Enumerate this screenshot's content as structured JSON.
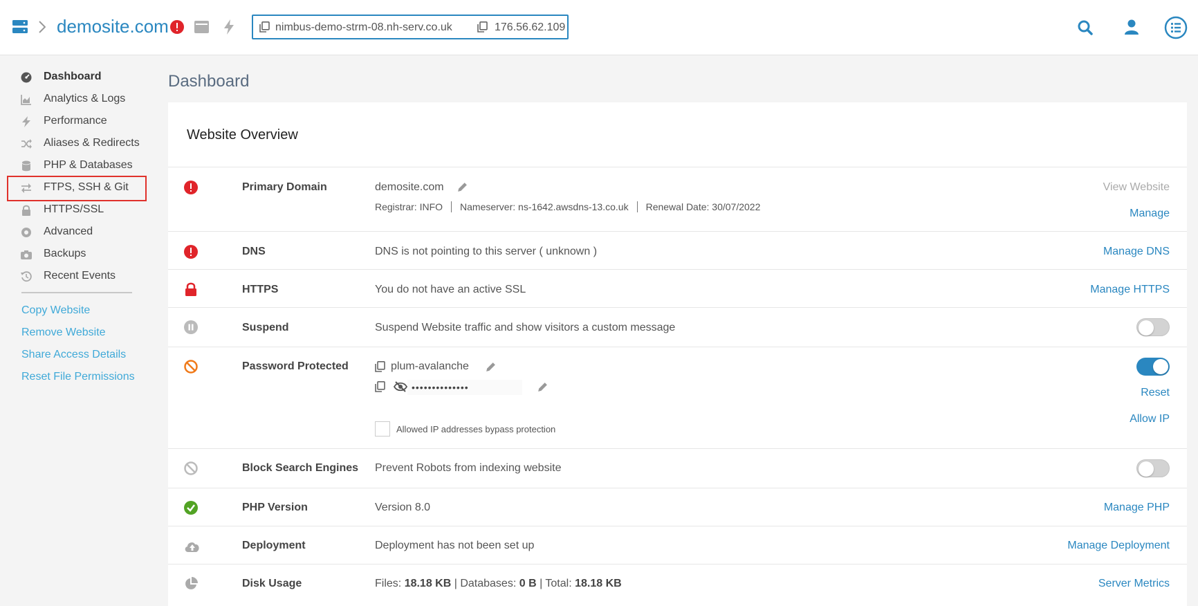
{
  "topbar": {
    "site_title": "demosite.com",
    "hostname": "nimbus-demo-strm-08.nh-serv.co.uk",
    "ip_address": "176.56.62.109"
  },
  "sidebar": {
    "items": [
      {
        "label": "Dashboard",
        "icon": "dashboard-icon",
        "active": true
      },
      {
        "label": "Analytics & Logs",
        "icon": "chart-icon"
      },
      {
        "label": "Performance",
        "icon": "bolt-icon"
      },
      {
        "label": "Aliases & Redirects",
        "icon": "shuffle-icon"
      },
      {
        "label": "PHP & Databases",
        "icon": "database-icon"
      },
      {
        "label": "FTPS, SSH & Git",
        "icon": "exchange-icon",
        "highlighted": true
      },
      {
        "label": "HTTPS/SSL",
        "icon": "lock-icon"
      },
      {
        "label": "Advanced",
        "icon": "advanced-icon"
      },
      {
        "label": "Backups",
        "icon": "camera-icon"
      },
      {
        "label": "Recent Events",
        "icon": "history-icon"
      }
    ],
    "links": [
      "Copy Website",
      "Remove Website",
      "Share Access Details",
      "Reset File Permissions"
    ]
  },
  "main": {
    "page_title": "Dashboard",
    "card_title": "Website Overview",
    "rows": {
      "primary_domain": {
        "label": "Primary Domain",
        "value": "demosite.com",
        "registrar": "Registrar: INFO",
        "nameserver": "Nameserver: ns-1642.awsdns-13.co.uk",
        "renewal": "Renewal Date: 30/07/2022",
        "action_view": "View Website",
        "action_manage": "Manage"
      },
      "dns": {
        "label": "DNS",
        "text": "DNS is not pointing to this server ( unknown )",
        "action": "Manage DNS"
      },
      "https": {
        "label": "HTTPS",
        "text": "You do not have an active SSL",
        "action": "Manage HTTPS"
      },
      "suspend": {
        "label": "Suspend",
        "text": "Suspend Website traffic and show visitors a custom message",
        "enabled": false
      },
      "password": {
        "label": "Password Protected",
        "username": "plum-avalanche",
        "password_mask": "••••••••••••••",
        "checkbox_label": "Allowed IP addresses bypass protection",
        "enabled": true,
        "action_reset": "Reset",
        "action_allow": "Allow IP"
      },
      "block_search": {
        "label": "Block Search Engines",
        "text": "Prevent Robots from indexing website",
        "enabled": false
      },
      "php": {
        "label": "PHP Version",
        "text": "Version 8.0",
        "action": "Manage PHP"
      },
      "deployment": {
        "label": "Deployment",
        "text": "Deployment has not been set up",
        "action": "Manage Deployment"
      },
      "disk": {
        "label": "Disk Usage",
        "files_label": "Files:",
        "files_value": "18.18 KB",
        "db_label": "Databases:",
        "db_value": "0 B",
        "total_label": "Total:",
        "total_value": "18.18 KB",
        "action": "Server Metrics"
      }
    }
  },
  "colors": {
    "accent": "#2a87c0",
    "link": "#3fa9d8",
    "error": "#e0242a",
    "warning": "#f07a1a",
    "success": "#52a324",
    "highlight": "#e0312b"
  }
}
